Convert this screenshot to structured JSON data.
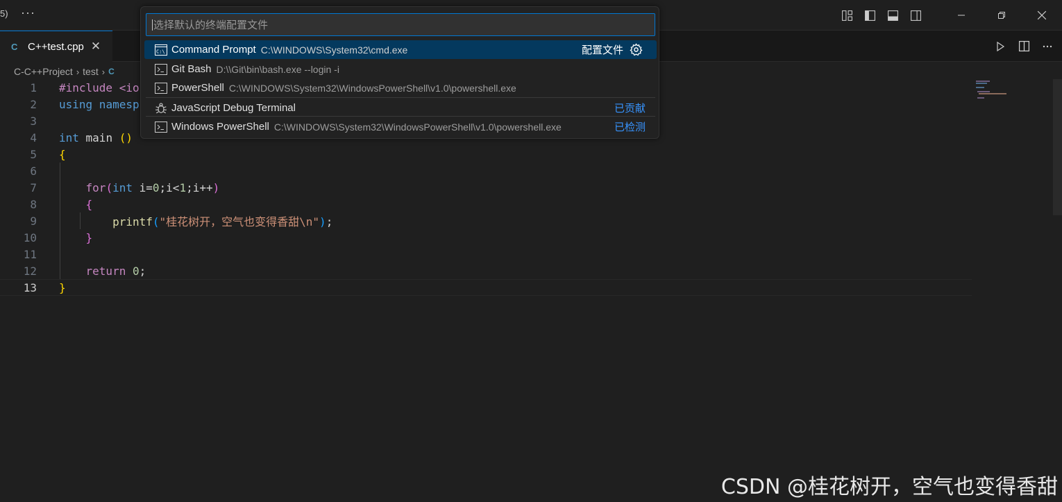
{
  "titlebar": {
    "edge_text": "5)",
    "more": "···"
  },
  "tab": {
    "icon": "C",
    "label": "C++test.cpp",
    "close": "✕"
  },
  "breadcrumb": {
    "items": [
      "C-C++Project",
      "test"
    ],
    "file_icon": "C"
  },
  "editor": {
    "line_numbers": [
      "1",
      "2",
      "3",
      "4",
      "5",
      "6",
      "7",
      "8",
      "9",
      "10",
      "11",
      "12",
      "13"
    ],
    "current_line": "13",
    "code": {
      "l1_a": "#include <io",
      "l2_a": "using",
      "l2_b": " namesp",
      "l4_a": "int",
      "l4_b": " main ",
      "l4_c": "()",
      "l5": "{",
      "l7_a": "for",
      "l7_b": "(",
      "l7_c": "int",
      "l7_d": " i=",
      "l7_e": "0",
      "l7_f": ";i<",
      "l7_g": "1",
      "l7_h": ";i++",
      "l7_i": ")",
      "l8": "{",
      "l9_a": "printf",
      "l9_b": "(",
      "l9_c": "\"桂花树开，空气也变得香甜\\n\"",
      "l9_d": ")",
      "l9_e": ";",
      "l10": "}",
      "l12_a": "return",
      "l12_b": " ",
      "l12_c": "0",
      "l12_d": ";",
      "l13": "}"
    }
  },
  "quickpick": {
    "placeholder": "选择默认的终端配置文件",
    "items": [
      {
        "label": "Command Prompt",
        "desc": "C:\\WINDOWS\\System32\\cmd.exe",
        "right": "配置文件",
        "selected": true
      },
      {
        "label": "Git Bash",
        "desc": "D:\\\\Git\\bin\\bash.exe --login -i",
        "right": ""
      },
      {
        "label": "PowerShell",
        "desc": "C:\\WINDOWS\\System32\\WindowsPowerShell\\v1.0\\powershell.exe",
        "right": ""
      },
      {
        "label": "JavaScript Debug Terminal",
        "desc": "",
        "right": "已贡献"
      },
      {
        "label": "Windows PowerShell",
        "desc": "C:\\WINDOWS\\System32\\WindowsPowerShell\\v1.0\\powershell.exe",
        "right": "已检测"
      }
    ]
  },
  "watermark": "CSDN @桂花树开，空气也变得香甜",
  "colors": {
    "accent": "#0078d4",
    "selection": "#04395e",
    "link": "#3794ff",
    "background": "#1f1f1f"
  }
}
